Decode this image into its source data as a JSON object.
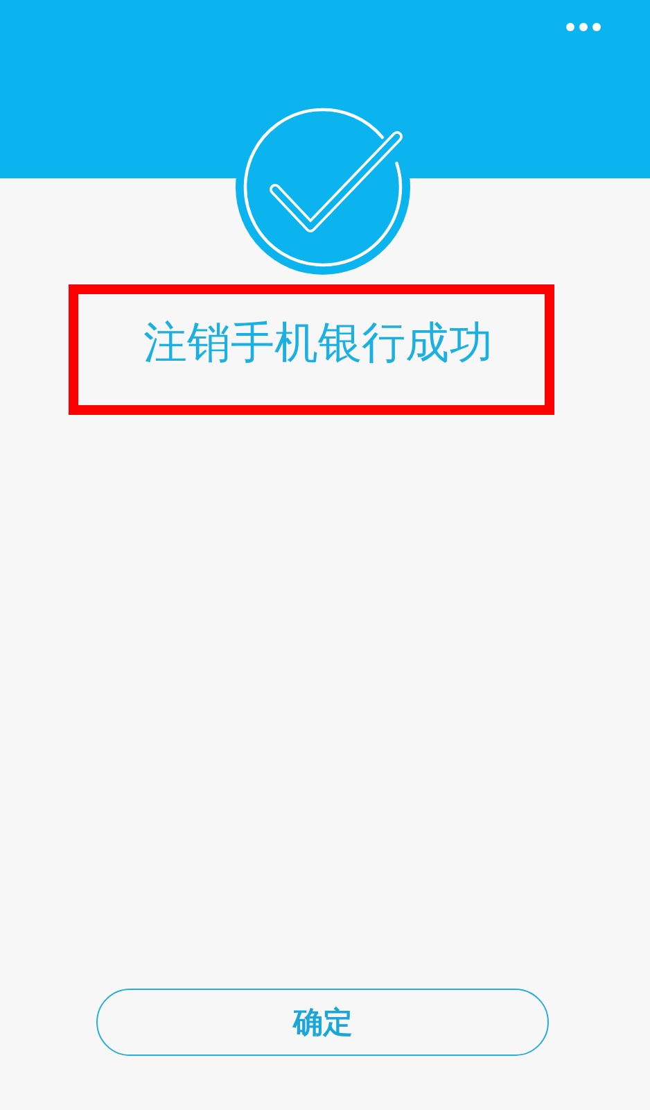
{
  "message": {
    "text": "注销手机银行成功",
    "highlighted": true
  },
  "confirm_button": {
    "label": "确定"
  }
}
